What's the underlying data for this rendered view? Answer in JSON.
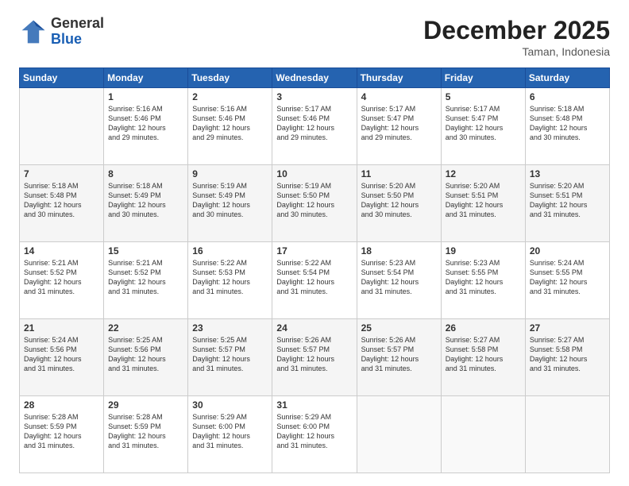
{
  "header": {
    "logo_general": "General",
    "logo_blue": "Blue",
    "month_title": "December 2025",
    "location": "Taman, Indonesia"
  },
  "days_of_week": [
    "Sunday",
    "Monday",
    "Tuesday",
    "Wednesday",
    "Thursday",
    "Friday",
    "Saturday"
  ],
  "weeks": [
    [
      {
        "day": "",
        "info": ""
      },
      {
        "day": "1",
        "info": "Sunrise: 5:16 AM\nSunset: 5:46 PM\nDaylight: 12 hours\nand 29 minutes."
      },
      {
        "day": "2",
        "info": "Sunrise: 5:16 AM\nSunset: 5:46 PM\nDaylight: 12 hours\nand 29 minutes."
      },
      {
        "day": "3",
        "info": "Sunrise: 5:17 AM\nSunset: 5:46 PM\nDaylight: 12 hours\nand 29 minutes."
      },
      {
        "day": "4",
        "info": "Sunrise: 5:17 AM\nSunset: 5:47 PM\nDaylight: 12 hours\nand 29 minutes."
      },
      {
        "day": "5",
        "info": "Sunrise: 5:17 AM\nSunset: 5:47 PM\nDaylight: 12 hours\nand 30 minutes."
      },
      {
        "day": "6",
        "info": "Sunrise: 5:18 AM\nSunset: 5:48 PM\nDaylight: 12 hours\nand 30 minutes."
      }
    ],
    [
      {
        "day": "7",
        "info": "Sunrise: 5:18 AM\nSunset: 5:48 PM\nDaylight: 12 hours\nand 30 minutes."
      },
      {
        "day": "8",
        "info": "Sunrise: 5:18 AM\nSunset: 5:49 PM\nDaylight: 12 hours\nand 30 minutes."
      },
      {
        "day": "9",
        "info": "Sunrise: 5:19 AM\nSunset: 5:49 PM\nDaylight: 12 hours\nand 30 minutes."
      },
      {
        "day": "10",
        "info": "Sunrise: 5:19 AM\nSunset: 5:50 PM\nDaylight: 12 hours\nand 30 minutes."
      },
      {
        "day": "11",
        "info": "Sunrise: 5:20 AM\nSunset: 5:50 PM\nDaylight: 12 hours\nand 30 minutes."
      },
      {
        "day": "12",
        "info": "Sunrise: 5:20 AM\nSunset: 5:51 PM\nDaylight: 12 hours\nand 31 minutes."
      },
      {
        "day": "13",
        "info": "Sunrise: 5:20 AM\nSunset: 5:51 PM\nDaylight: 12 hours\nand 31 minutes."
      }
    ],
    [
      {
        "day": "14",
        "info": "Sunrise: 5:21 AM\nSunset: 5:52 PM\nDaylight: 12 hours\nand 31 minutes."
      },
      {
        "day": "15",
        "info": "Sunrise: 5:21 AM\nSunset: 5:52 PM\nDaylight: 12 hours\nand 31 minutes."
      },
      {
        "day": "16",
        "info": "Sunrise: 5:22 AM\nSunset: 5:53 PM\nDaylight: 12 hours\nand 31 minutes."
      },
      {
        "day": "17",
        "info": "Sunrise: 5:22 AM\nSunset: 5:54 PM\nDaylight: 12 hours\nand 31 minutes."
      },
      {
        "day": "18",
        "info": "Sunrise: 5:23 AM\nSunset: 5:54 PM\nDaylight: 12 hours\nand 31 minutes."
      },
      {
        "day": "19",
        "info": "Sunrise: 5:23 AM\nSunset: 5:55 PM\nDaylight: 12 hours\nand 31 minutes."
      },
      {
        "day": "20",
        "info": "Sunrise: 5:24 AM\nSunset: 5:55 PM\nDaylight: 12 hours\nand 31 minutes."
      }
    ],
    [
      {
        "day": "21",
        "info": "Sunrise: 5:24 AM\nSunset: 5:56 PM\nDaylight: 12 hours\nand 31 minutes."
      },
      {
        "day": "22",
        "info": "Sunrise: 5:25 AM\nSunset: 5:56 PM\nDaylight: 12 hours\nand 31 minutes."
      },
      {
        "day": "23",
        "info": "Sunrise: 5:25 AM\nSunset: 5:57 PM\nDaylight: 12 hours\nand 31 minutes."
      },
      {
        "day": "24",
        "info": "Sunrise: 5:26 AM\nSunset: 5:57 PM\nDaylight: 12 hours\nand 31 minutes."
      },
      {
        "day": "25",
        "info": "Sunrise: 5:26 AM\nSunset: 5:57 PM\nDaylight: 12 hours\nand 31 minutes."
      },
      {
        "day": "26",
        "info": "Sunrise: 5:27 AM\nSunset: 5:58 PM\nDaylight: 12 hours\nand 31 minutes."
      },
      {
        "day": "27",
        "info": "Sunrise: 5:27 AM\nSunset: 5:58 PM\nDaylight: 12 hours\nand 31 minutes."
      }
    ],
    [
      {
        "day": "28",
        "info": "Sunrise: 5:28 AM\nSunset: 5:59 PM\nDaylight: 12 hours\nand 31 minutes."
      },
      {
        "day": "29",
        "info": "Sunrise: 5:28 AM\nSunset: 5:59 PM\nDaylight: 12 hours\nand 31 minutes."
      },
      {
        "day": "30",
        "info": "Sunrise: 5:29 AM\nSunset: 6:00 PM\nDaylight: 12 hours\nand 31 minutes."
      },
      {
        "day": "31",
        "info": "Sunrise: 5:29 AM\nSunset: 6:00 PM\nDaylight: 12 hours\nand 31 minutes."
      },
      {
        "day": "",
        "info": ""
      },
      {
        "day": "",
        "info": ""
      },
      {
        "day": "",
        "info": ""
      }
    ]
  ]
}
